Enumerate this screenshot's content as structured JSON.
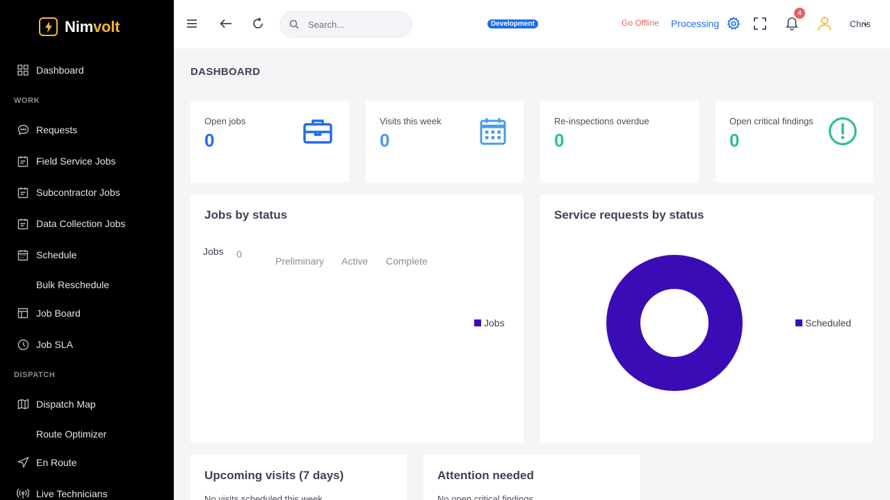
{
  "brand": {
    "name_part1": "Nim",
    "name_part2": "volt"
  },
  "sidebar": {
    "dashboard": "Dashboard",
    "section_work": "WORK",
    "requests": "Requests",
    "field_service_jobs": "Field Service Jobs",
    "subcontractor_jobs": "Subcontractor Jobs",
    "data_collection_jobs": "Data Collection Jobs",
    "schedule": "Schedule",
    "bulk_reschedule": "Bulk Reschedule",
    "job_board": "Job Board",
    "job_sla": "Job SLA",
    "section_dispatch": "DISPATCH",
    "dispatch_map": "Dispatch Map",
    "route_optimizer": "Route Optimizer",
    "en_route": "En Route",
    "live_technicians": "Live Technicians"
  },
  "topbar": {
    "search_placeholder": "Search...",
    "env_badge": "Development",
    "go_offline": "Go Offline",
    "processing": "Processing",
    "notifications_count": "4",
    "user_name": "Chris"
  },
  "page": {
    "title": "DASHBOARD"
  },
  "stats": [
    {
      "label": "Open jobs",
      "value": "0",
      "color": "#1d6cf0",
      "icon": "briefcase-icon"
    },
    {
      "label": "Visits this week",
      "value": "0",
      "color": "#4a9ae8",
      "icon": "calendar-icon"
    },
    {
      "label": "Re-inspections overdue",
      "value": "0",
      "color": "#2ebf91",
      "icon": ""
    },
    {
      "label": "Open critical findings",
      "value": "0",
      "color": "#2ebf91",
      "icon": "alert-circle-icon"
    }
  ],
  "jobs_by_status": {
    "title": "Jobs by status",
    "row_label": "Jobs",
    "row_value": "0",
    "columns": [
      "Preliminary",
      "Active",
      "Complete"
    ],
    "legend": "Jobs",
    "legend_color": "#3a0cb5"
  },
  "service_requests": {
    "title": "Service requests by status",
    "legend": "Scheduled",
    "legend_color": "#3a0cb5"
  },
  "chart_data": {
    "type": "pie",
    "title": "Service requests by status",
    "series": [
      {
        "name": "Scheduled",
        "values": [
          1
        ]
      }
    ],
    "categories": [
      "Scheduled"
    ],
    "donut": true
  },
  "upcoming": {
    "title": "Upcoming visits (7 days)",
    "empty": "No visits scheduled this week"
  },
  "attention": {
    "title": "Attention needed",
    "empty": "No open critical findings"
  }
}
